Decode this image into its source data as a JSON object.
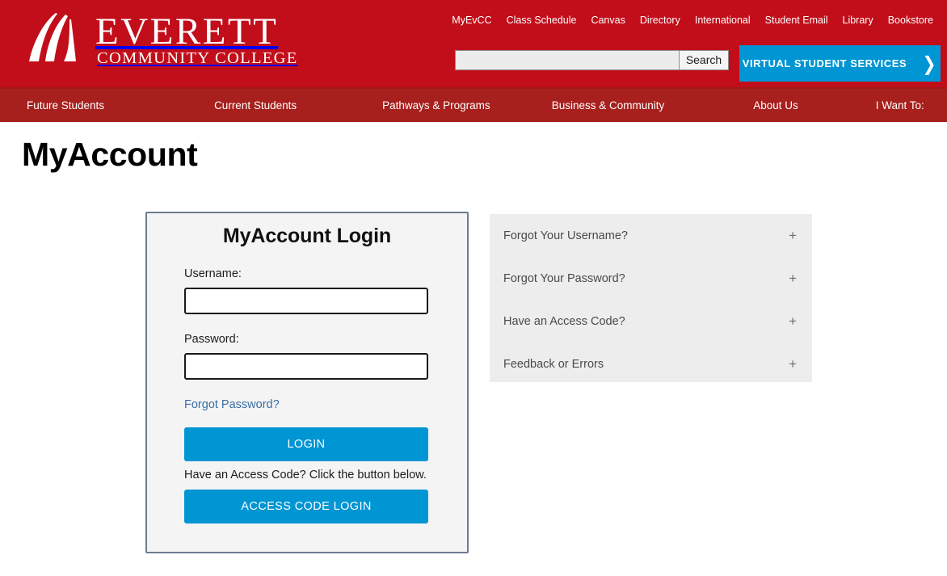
{
  "site": {
    "logo_title": "EVERETT",
    "logo_subtitle": "COMMUNITY COLLEGE",
    "logo_icon": "evcc-swoosh-logo"
  },
  "utility_nav": {
    "items": [
      {
        "label": "MyEvCC"
      },
      {
        "label": "Class Schedule"
      },
      {
        "label": "Canvas"
      },
      {
        "label": "Directory"
      },
      {
        "label": "International"
      },
      {
        "label": "Student Email"
      },
      {
        "label": "Library"
      },
      {
        "label": "Bookstore"
      }
    ]
  },
  "search": {
    "value": "",
    "placeholder": "",
    "button_label": "Search",
    "icon": "search-icon"
  },
  "virtual_student_services": {
    "label": "VIRTUAL STUDENT SERVICES",
    "chevron": "❯",
    "background": "#0095d3"
  },
  "main_nav": {
    "items": [
      {
        "label": "Future Students"
      },
      {
        "label": "Current Students"
      },
      {
        "label": "Pathways & Programs"
      },
      {
        "label": "Business & Community"
      },
      {
        "label": "About Us"
      },
      {
        "label": "I Want To:"
      }
    ]
  },
  "page": {
    "title": "MyAccount"
  },
  "login_card": {
    "heading": "MyAccount Login",
    "username_label": "Username:",
    "username_value": "",
    "username_placeholder": "",
    "password_label": "Password:",
    "password_value": "",
    "password_placeholder": "",
    "forgot_password_link": "Forgot Password?",
    "login_button": "LOGIN",
    "access_code_note": "Have an Access Code? Click the button below.",
    "access_code_button": "ACCESS CODE LOGIN"
  },
  "help_accordion": {
    "items": [
      {
        "label": "Forgot Your Username?",
        "toggle": "+"
      },
      {
        "label": "Forgot Your Password?",
        "toggle": "+"
      },
      {
        "label": "Have an Access Code?",
        "toggle": "+"
      },
      {
        "label": "Feedback or Errors",
        "toggle": "+"
      }
    ]
  },
  "colors": {
    "header_red": "#c20e1a",
    "nav_red": "#a7201d",
    "accent_blue": "#0095d3",
    "link_blue": "#3a6ea5",
    "card_bg": "#f4f4f4",
    "card_border": "#6b7c91",
    "accordion_bg": "#ededed"
  }
}
